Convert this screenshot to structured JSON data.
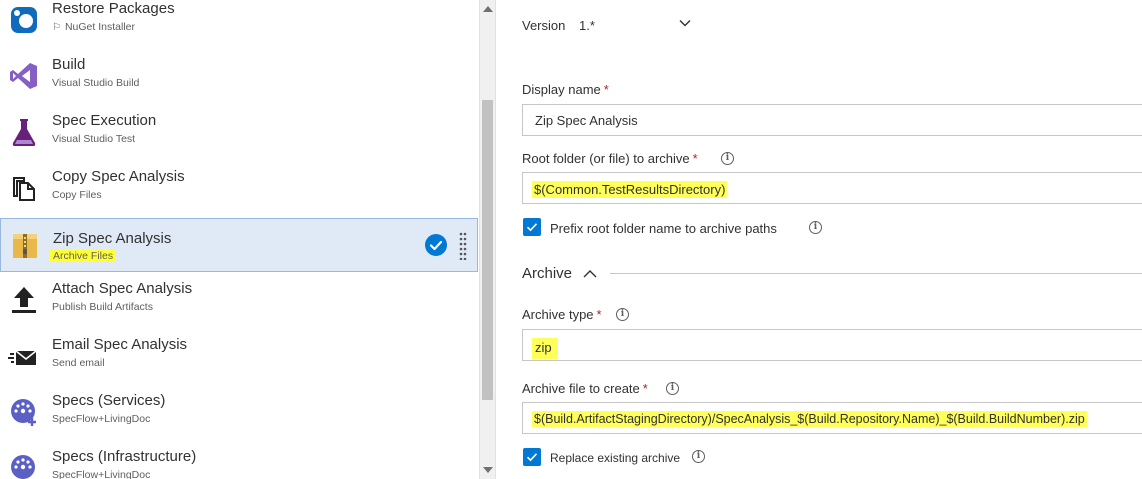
{
  "tasks": [
    {
      "name": "Restore Packages",
      "subtitle": "NuGet Installer",
      "icon": "nuget-icon",
      "flagged": true
    },
    {
      "name": "Build",
      "subtitle": "Visual Studio Build",
      "icon": "visual-studio-icon"
    },
    {
      "name": "Spec Execution",
      "subtitle": "Visual Studio Test",
      "icon": "flask-icon"
    },
    {
      "name": "Copy Spec Analysis",
      "subtitle": "Copy Files",
      "icon": "copy-files-icon"
    },
    {
      "name": "Zip Spec Analysis",
      "subtitle": "Archive Files",
      "icon": "archive-icon",
      "selected": true
    },
    {
      "name": "Attach Spec Analysis",
      "subtitle": "Publish Build Artifacts",
      "icon": "upload-icon"
    },
    {
      "name": "Email Spec Analysis",
      "subtitle": "Send email",
      "icon": "email-icon"
    },
    {
      "name": "Specs (Services)",
      "subtitle": "SpecFlow+LivingDoc",
      "icon": "specflow-icon"
    },
    {
      "name": "Specs (Infrastructure)",
      "subtitle": "SpecFlow+LivingDoc",
      "icon": "specflow-icon"
    }
  ],
  "properties": {
    "version_label": "Version",
    "version_value": "1.*",
    "display_name_label": "Display name",
    "display_name_value": "Zip Spec Analysis",
    "root_folder_label": "Root folder (or file) to archive",
    "root_folder_value": "$(Common.TestResultsDirectory)",
    "prefix_label": "Prefix root folder name to archive paths",
    "archive_section": "Archive",
    "archive_type_label": "Archive type",
    "archive_type_value": "zip",
    "archive_file_label": "Archive file to create",
    "archive_file_value": "$(Build.ArtifactStagingDirectory)/SpecAnalysis_$(Build.Repository.Name)_$(Build.BuildNumber).zip",
    "replace_label": "Replace existing archive",
    "required_mark": "*"
  },
  "colors": {
    "accent": "#0078d4",
    "highlight": "#ffff33",
    "selected_row": "#dfeaf6"
  }
}
